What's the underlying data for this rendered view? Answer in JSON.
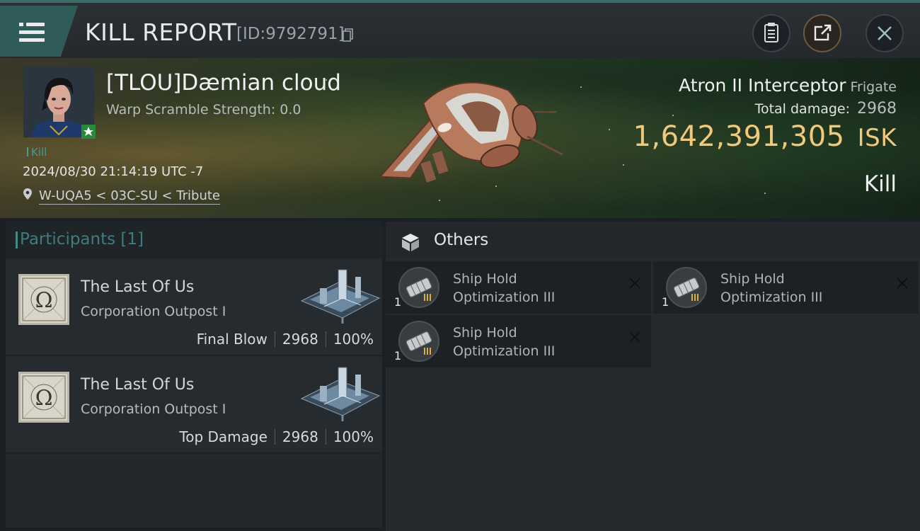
{
  "header": {
    "title": "KILL REPORT",
    "report_id": "[ID:9792791]",
    "icons": [
      "menu-icon",
      "copy-icon",
      "clipboard-icon",
      "share-icon",
      "close-icon"
    ]
  },
  "victim": {
    "name": "[TLOU]Dæmian cloud",
    "warp_scramble": "Warp Scramble Strength: 0.0",
    "tag": "Kill",
    "datetime": "2024/08/30 21:14:19 UTC -7",
    "location": "W-UQA5 < 03C-SU < Tribute"
  },
  "ship": {
    "name": "Atron II Interceptor",
    "class": "Frigate",
    "total_damage_label": "Total damage:",
    "total_damage": "2968",
    "isk_value": "1,642,391,305",
    "isk_unit": "ISK",
    "result": "Kill"
  },
  "participants": {
    "title": "Participants [1]",
    "rows": [
      {
        "name": "The Last Of Us",
        "sub": "Corporation Outpost I",
        "role": "Final Blow",
        "damage": "2968",
        "percent": "100%"
      },
      {
        "name": "The Last Of Us",
        "sub": "Corporation Outpost I",
        "role": "Top Damage",
        "damage": "2968",
        "percent": "100%"
      }
    ]
  },
  "others": {
    "title": "Others",
    "items": [
      {
        "qty": "1",
        "name": "Ship Hold Optimization III"
      },
      {
        "qty": "1",
        "name": "Ship Hold Optimization III"
      },
      {
        "qty": "1",
        "name": "Ship Hold Optimization III"
      }
    ]
  },
  "colors": {
    "accent_teal": "#3f8c88",
    "isk_gold": "#f0c97a",
    "kill_tag": "#4a9a90"
  }
}
